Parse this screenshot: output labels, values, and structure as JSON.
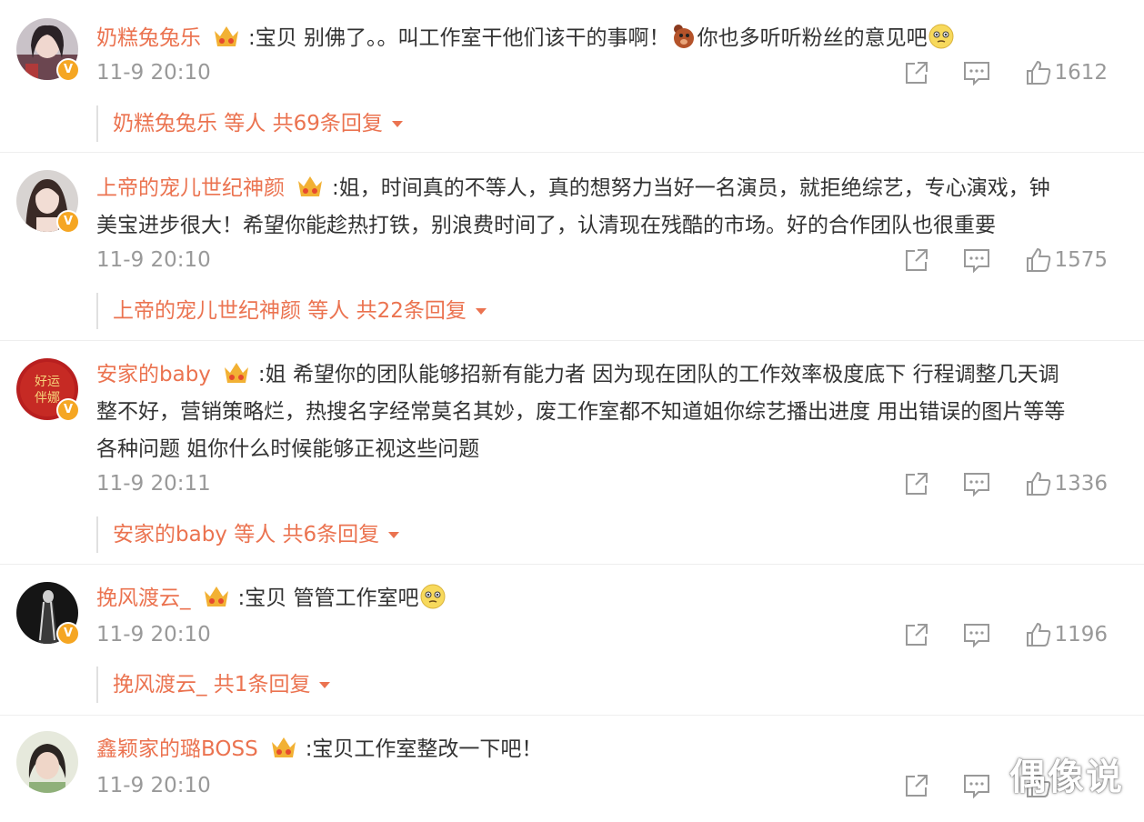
{
  "comments": [
    {
      "username": "奶糕兔兔乐",
      "content": ":宝贝 别佛了。。叫工作室干他们该干的事啊！",
      "content2": "你也多听听粉丝的意见吧",
      "time": "11-9 20:10",
      "likes": "1612",
      "replies": "奶糕兔兔乐 等人 共69条回复"
    },
    {
      "username": "上帝的宠儿世纪神颜",
      "content": ":姐，时间真的不等人，真的想努力当好一名演员，就拒绝综艺，专心演戏，钟",
      "content2": "美宝进步很大！希望你能趁热打铁，别浪费时间了，认清现在残酷的市场。好的合作团队也很重要",
      "time": "11-9 20:10",
      "likes": "1575",
      "replies": "上帝的宠儿世纪神颜 等人 共22条回复"
    },
    {
      "username": "安家的baby",
      "content": ":姐 希望你的团队能够招新有能力者 因为现在团队的工作效率极度底下 行程调整几天调",
      "content2": "整不好，营销策略烂，热搜名字经常莫名其妙，废工作室都不知道姐你综艺播出进度 用出错误的图片等等",
      "content3": "各种问题 姐你什么时候能够正视这些问题",
      "avatar_text": "好运 伴娜",
      "time": "11-9 20:11",
      "likes": "1336",
      "replies": "安家的baby 等人 共6条回复"
    },
    {
      "username": "挽风渡云_",
      "content": ":宝贝 管管工作室吧",
      "time": "11-9 20:10",
      "likes": "1196",
      "replies": "挽风渡云_ 共1条回复"
    },
    {
      "username": "鑫颖家的璐BOSS",
      "content": ":宝贝工作室整改一下吧！",
      "time": "11-9 20:10",
      "likes": ""
    }
  ],
  "watermark": "偶像说",
  "icons": {
    "share": "share-icon",
    "comment": "comment-icon",
    "like": "like-icon",
    "crown": "crown-badge-icon",
    "verified": "verified-badge-icon",
    "expand": "chevron-down-icon"
  },
  "colors": {
    "username": "#eb7350",
    "meta": "#999999",
    "text": "#333333",
    "badge": "#f5a623"
  }
}
